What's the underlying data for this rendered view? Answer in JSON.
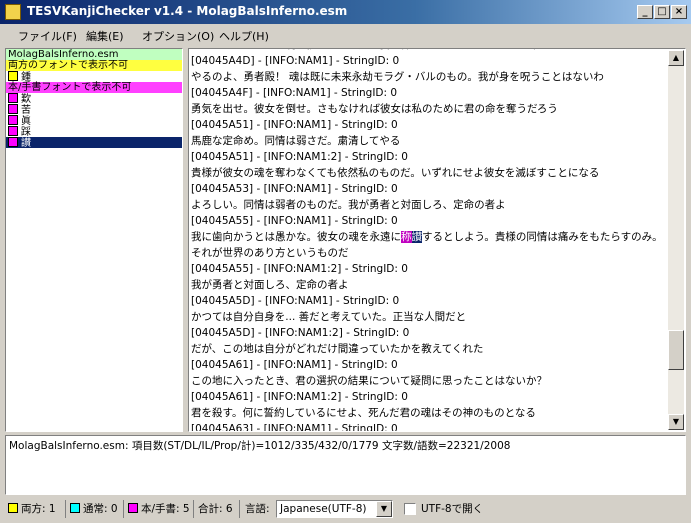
{
  "window": {
    "title": "TESVKanjiChecker v1.4 - MolagBalsInferno.esm"
  },
  "menu": [
    "ファイル(F)",
    "編集(E)",
    "オプション(O)",
    "ヘルプ(H)"
  ],
  "left_list": [
    {
      "text": "MolagBalsInferno.esm",
      "kind": "header-green"
    },
    {
      "text": "両方のフォントで表示不可",
      "kind": "header-yellow"
    },
    {
      "text": "鍾",
      "kind": "item",
      "swatch": "#ffff00"
    },
    {
      "text": "本/手書フォントで表示不可",
      "kind": "header-magenta"
    },
    {
      "text": "歎",
      "kind": "item",
      "swatch": "#ff00ff"
    },
    {
      "text": "苦",
      "kind": "item",
      "swatch": "#ff00ff"
    },
    {
      "text": "眞",
      "kind": "item",
      "swatch": "#ff00ff"
    },
    {
      "text": "踩",
      "kind": "item",
      "swatch": "#ff00ff"
    },
    {
      "text": "讃",
      "kind": "selected",
      "swatch": "#ff00ff"
    }
  ],
  "text_lines": [
    {
      "text": "ノマノノをロナいる晩を依ふしてる返に我の神たらしてるのだ。いくさ 来りんなど"
    },
    {
      "text": "[04045A4D] - [INFO:NAM1] -    StringID: 0"
    },
    {
      "text": "やるのよ、勇者殿！ 魂は既に未来永劫モラグ・バルのもの。我が身を呪うことはないわ"
    },
    {
      "text": "[04045A4F] - [INFO:NAM1] -    StringID: 0"
    },
    {
      "text": "勇気を出せ。彼女を倒せ。さもなければ彼女は私のために君の命を奪うだろう"
    },
    {
      "text": "[04045A51] - [INFO:NAM1] -    StringID: 0"
    },
    {
      "text": "馬鹿な定命め。同情は弱さだ。粛清してやる"
    },
    {
      "text": "[04045A51] - [INFO:NAM1:2] -    StringID: 0"
    },
    {
      "text": "貴様が彼女の魂を奪わなくても依然私のものだ。いずれにせよ彼女を滅ぼすことになる"
    },
    {
      "text": "[04045A53] - [INFO:NAM1] -    StringID: 0"
    },
    {
      "text": "よろしい。同情は弱者のものだ。我が勇者と対面しろ、定命の者よ"
    },
    {
      "text": "[04045A55] - [INFO:NAM1] -    StringID: 0"
    },
    {
      "before": "我に歯向かうとは愚かな。彼女の魂を永遠に",
      "hl1": "称",
      "hl2": "讃",
      "after": "するとしよう。貴様の同情は痛みをもたらすのみ。それが世界のあり方というものだ",
      "wrap": true
    },
    {
      "text": "[04045A55] - [INFO:NAM1:2] -    StringID: 0"
    },
    {
      "text": "我が勇者と対面しろ、定命の者よ"
    },
    {
      "text": "[04045A5D] - [INFO:NAM1] -    StringID: 0"
    },
    {
      "text": "かつては自分自身を... 善だと考えていた。正当な人間だと"
    },
    {
      "text": "[04045A5D] - [INFO:NAM1:2] -    StringID: 0"
    },
    {
      "text": "だが、この地は自分がどれだけ間違っていたかを教えてくれた"
    },
    {
      "text": "[04045A61] - [INFO:NAM1] -    StringID: 0"
    },
    {
      "text": "この地に入ったとき、君の選択の結果について疑問に思ったことはないか？"
    },
    {
      "text": "[04045A61] - [INFO:NAM1:2] -    StringID: 0"
    },
    {
      "text": "君を殺す。何に誓約しているにせよ、死んだ君の魂はその神のものとなる"
    },
    {
      "text": "[04045A63] - [INFO:NAM1] -    StringID: 0"
    }
  ],
  "summary": "MolagBalsInferno.esm: 項目数(ST/DL/IL/Prop/計)=1012/335/432/0/1779 文字数/語数=22321/2008",
  "status": {
    "both_label": "両方: 1",
    "normal_label": "通常: 0",
    "book_label": "本/手書: 5",
    "total_label": "合計: 6",
    "language_label": "言語:",
    "language_value": "Japanese(UTF-8)",
    "utf8_label": "UTF-8で開く"
  },
  "colors": {
    "both": "#ffff00",
    "normal": "#00ffff",
    "book": "#ff00ff",
    "header_green": "#c0ffc0",
    "header_yellow": "#ffff40",
    "header_magenta": "#ff40ff",
    "selection": "#0a246a"
  }
}
